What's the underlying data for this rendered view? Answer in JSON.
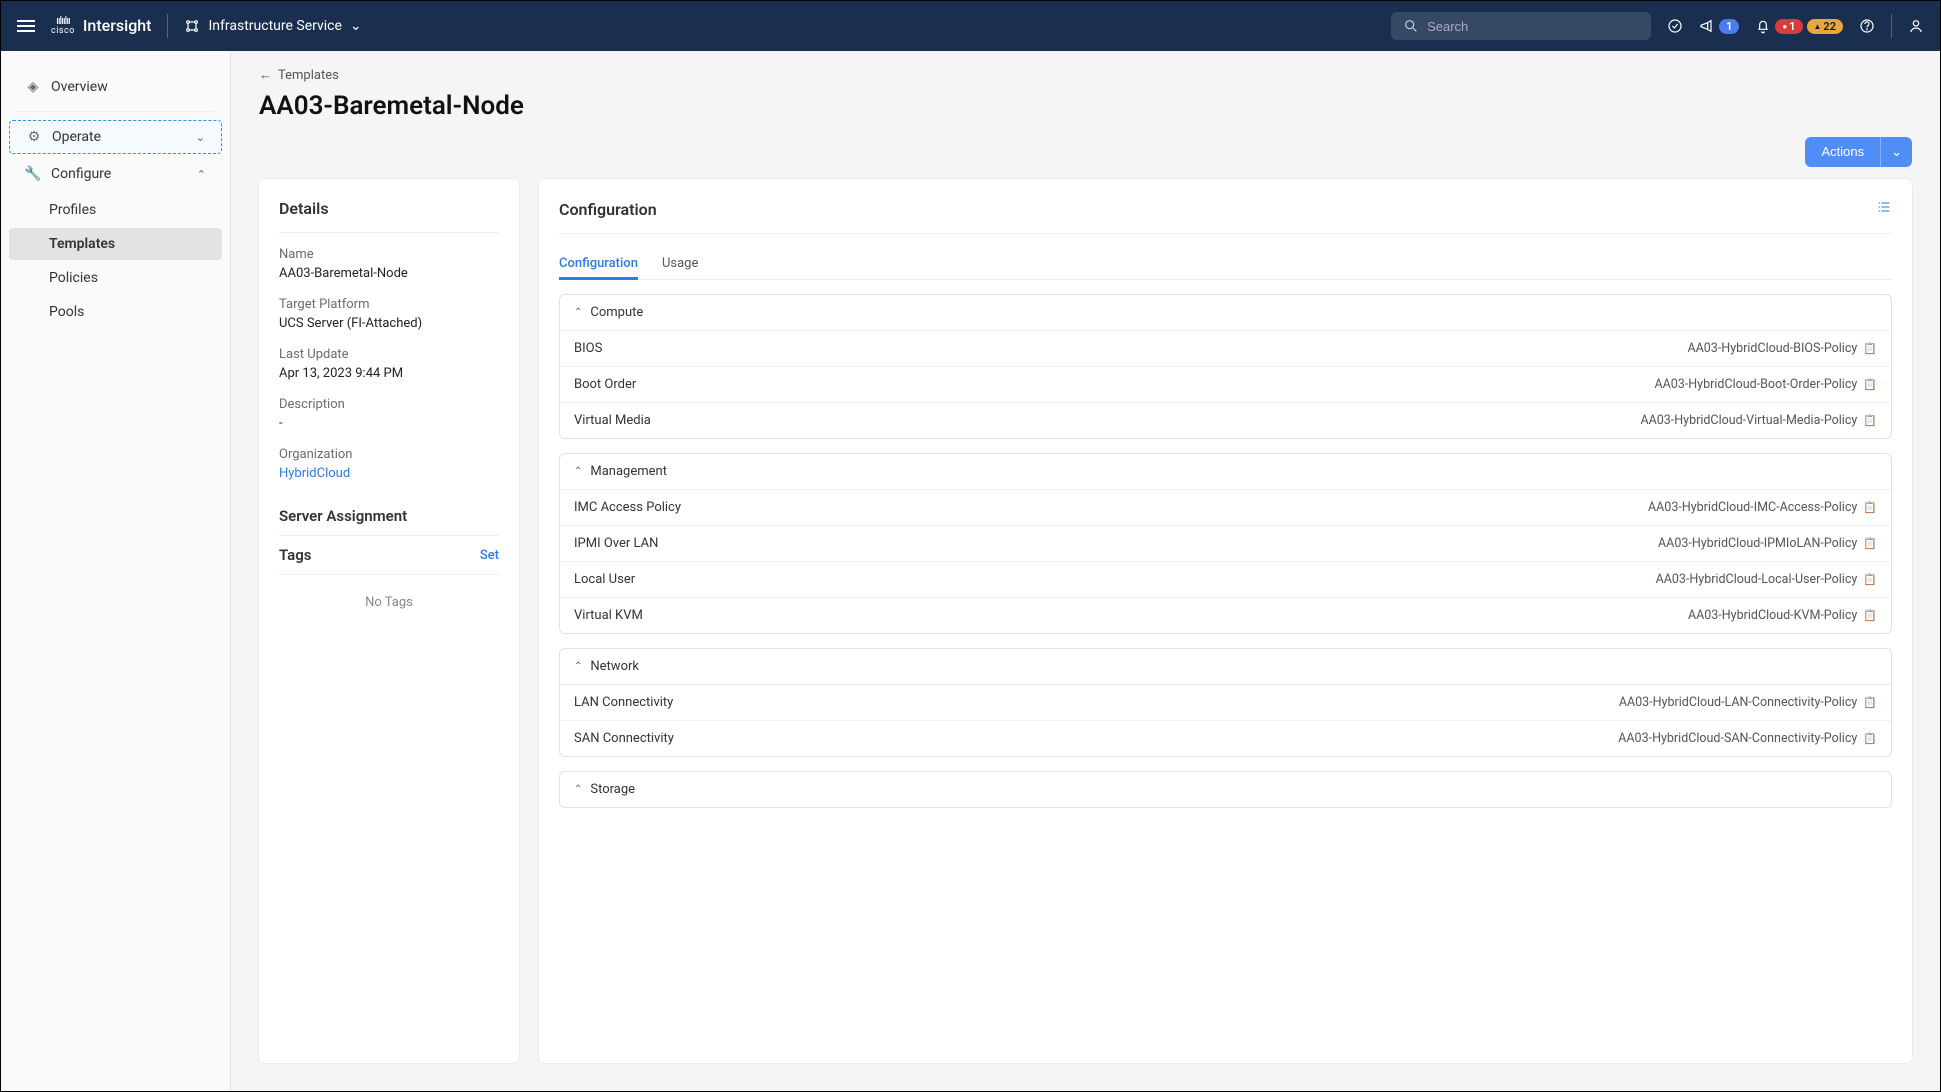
{
  "topbar": {
    "brand_vendor": "cisco",
    "brand_product": "Intersight",
    "service_label": "Infrastructure Service",
    "search_placeholder": "Search",
    "announce_count": "1",
    "error_count": "1",
    "warn_count": "22"
  },
  "sidebar": {
    "overview": "Overview",
    "operate": "Operate",
    "configure": "Configure",
    "items": {
      "profiles": "Profiles",
      "templates": "Templates",
      "policies": "Policies",
      "pools": "Pools"
    }
  },
  "breadcrumb": "Templates",
  "page_title": "AA03-Baremetal-Node",
  "actions_label": "Actions",
  "details": {
    "heading": "Details",
    "name_label": "Name",
    "name_value": "AA03-Baremetal-Node",
    "platform_label": "Target Platform",
    "platform_value": "UCS Server (FI-Attached)",
    "update_label": "Last Update",
    "update_value": "Apr 13, 2023 9:44 PM",
    "desc_label": "Description",
    "desc_value": "-",
    "org_label": "Organization",
    "org_value": "HybridCloud",
    "server_assignment": "Server Assignment",
    "tags_label": "Tags",
    "tags_set": "Set",
    "no_tags": "No Tags"
  },
  "config": {
    "heading": "Configuration",
    "tab_config": "Configuration",
    "tab_usage": "Usage",
    "groups": {
      "compute": {
        "title": "Compute",
        "rows": {
          "bios": {
            "label": "BIOS",
            "value": "AA03-HybridCloud-BIOS-Policy"
          },
          "boot": {
            "label": "Boot Order",
            "value": "AA03-HybridCloud-Boot-Order-Policy"
          },
          "vmedia": {
            "label": "Virtual Media",
            "value": "AA03-HybridCloud-Virtual-Media-Policy"
          }
        }
      },
      "management": {
        "title": "Management",
        "rows": {
          "imc": {
            "label": "IMC Access Policy",
            "value": "AA03-HybridCloud-IMC-Access-Policy"
          },
          "ipmi": {
            "label": "IPMI Over LAN",
            "value": "AA03-HybridCloud-IPMIoLAN-Policy"
          },
          "localuser": {
            "label": "Local User",
            "value": "AA03-HybridCloud-Local-User-Policy"
          },
          "vkvm": {
            "label": "Virtual KVM",
            "value": "AA03-HybridCloud-KVM-Policy"
          }
        }
      },
      "network": {
        "title": "Network",
        "rows": {
          "lan": {
            "label": "LAN Connectivity",
            "value": "AA03-HybridCloud-LAN-Connectivity-Policy"
          },
          "san": {
            "label": "SAN Connectivity",
            "value": "AA03-HybridCloud-SAN-Connectivity-Policy"
          }
        }
      },
      "storage": {
        "title": "Storage"
      }
    }
  }
}
